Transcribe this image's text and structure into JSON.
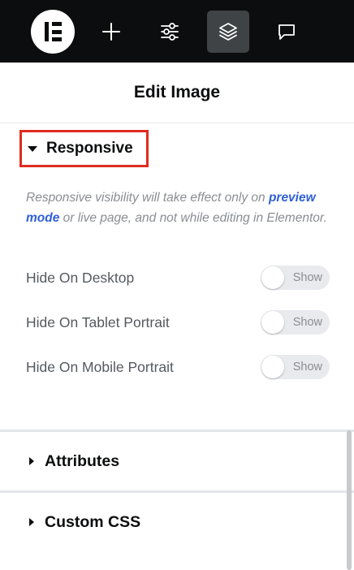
{
  "topbar": {
    "logo_icon": "elementor-logo-icon",
    "buttons": [
      {
        "icon": "plus-icon",
        "label": "Add Element",
        "active": false
      },
      {
        "icon": "sliders-icon",
        "label": "Site Settings",
        "active": false
      },
      {
        "icon": "layers-icon",
        "label": "Structure",
        "active": true
      },
      {
        "icon": "comment-icon",
        "label": "Comments",
        "active": false
      }
    ],
    "background": "#0c0d0e",
    "active_background": "#3f4346"
  },
  "header": {
    "title": "Edit Image"
  },
  "responsive": {
    "title": "Responsive",
    "expanded": true,
    "highlight_color": "#e02b20",
    "note": {
      "before": "Responsive visibility will take effect only on ",
      "link": "preview mode",
      "after": " or live page, and not while editing in Elementor."
    },
    "controls": [
      {
        "label": "Hide On Desktop",
        "switch_text": "Show",
        "on": false
      },
      {
        "label": "Hide On Tablet Portrait",
        "switch_text": "Show",
        "on": false
      },
      {
        "label": "Hide On Mobile Portrait",
        "switch_text": "Show",
        "on": false
      }
    ]
  },
  "sections": [
    {
      "title": "Attributes",
      "expanded": false
    },
    {
      "title": "Custom CSS",
      "expanded": false
    }
  ],
  "colors": {
    "link": "#2f5fd6",
    "muted_text": "#8a8d92"
  }
}
